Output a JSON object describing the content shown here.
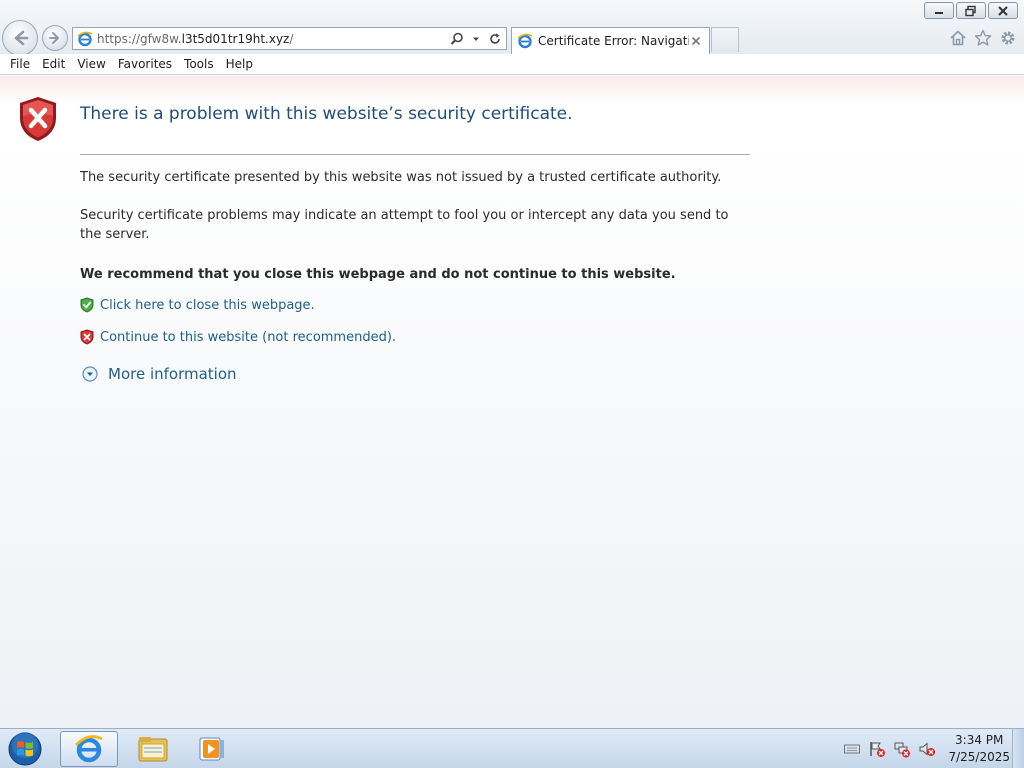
{
  "browser": {
    "address": {
      "url_prefix": "https://gfw8w.",
      "url_domain": "l3t5d01tr19ht.xyz",
      "url_suffix": "/"
    },
    "tab": {
      "title": "Certificate Error: Navigatio..."
    },
    "menu": [
      "File",
      "Edit",
      "View",
      "Favorites",
      "Tools",
      "Help"
    ]
  },
  "page": {
    "headline": "There is a problem with this website’s security certificate.",
    "para1": "The security certificate presented by this website was not issued by a trusted certificate authority.",
    "para2": "Security certificate problems may indicate an attempt to fool you or intercept any data you send to the server.",
    "recommendation": "We recommend that you close this webpage and do not continue to this website.",
    "close_link": "Click here to close this webpage.",
    "continue_link": "Continue to this website (not recommended).",
    "more_info": "More information"
  },
  "taskbar": {
    "clock_time": "3:34 PM",
    "clock_date": "7/25/2025"
  },
  "colors": {
    "link": "#1f5f8b",
    "headline": "#1f4e79",
    "shield_red": "#c8272a",
    "shield_green": "#3d9a3a"
  },
  "icons": {
    "back": "back-arrow-icon",
    "forward": "forward-arrow-icon",
    "search": "search-icon",
    "refresh": "refresh-icon",
    "home": "home-icon",
    "favorites": "star-icon",
    "tools": "gear-icon"
  }
}
